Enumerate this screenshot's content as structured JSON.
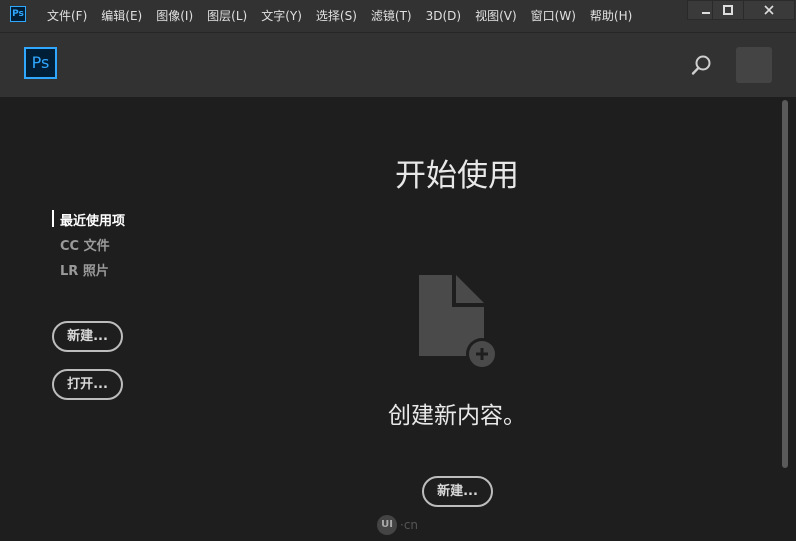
{
  "menubar": {
    "app_icon": "Ps",
    "items": [
      "文件(F)",
      "编辑(E)",
      "图像(I)",
      "图层(L)",
      "文字(Y)",
      "选择(S)",
      "滤镜(T)",
      "3D(D)",
      "视图(V)",
      "窗口(W)",
      "帮助(H)"
    ]
  },
  "header": {
    "logo": "Ps",
    "search_icon": "search-icon",
    "accent_color": "#31a8ff"
  },
  "sidebar": {
    "links": [
      "最近使用项",
      "CC 文件",
      "LR 照片"
    ],
    "new_label": "新建...",
    "open_label": "打开..."
  },
  "main": {
    "title": "开始使用",
    "create_text": "创建新内容。",
    "new_label": "新建..."
  },
  "watermark": {
    "badge": "UI",
    "text": "·cn"
  }
}
